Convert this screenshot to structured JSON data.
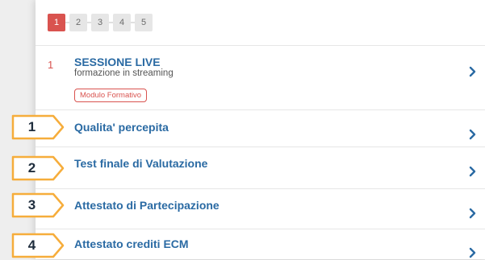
{
  "pagination": {
    "pages": [
      "1",
      "2",
      "3",
      "4",
      "5"
    ],
    "active_index": 0
  },
  "steps": [
    {
      "number": "1",
      "title": "SESSIONE LIVE",
      "subtitle": "formazione in streaming",
      "badge": "Modulo Formativo"
    },
    {
      "title": "Qualita' percepita",
      "callout": "1"
    },
    {
      "title": "Test finale di Valutazione",
      "callout": "2"
    },
    {
      "title": "Attestato di Partecipazione",
      "callout": "3"
    },
    {
      "title": "Attestato crediti ECM",
      "callout": "4"
    }
  ],
  "colors": {
    "accent_red": "#d9534f",
    "link_blue": "#2a6aa3",
    "chevron": "#2a6aa3",
    "callout_border": "#f6ad3b",
    "callout_text": "#1f2d3d"
  }
}
